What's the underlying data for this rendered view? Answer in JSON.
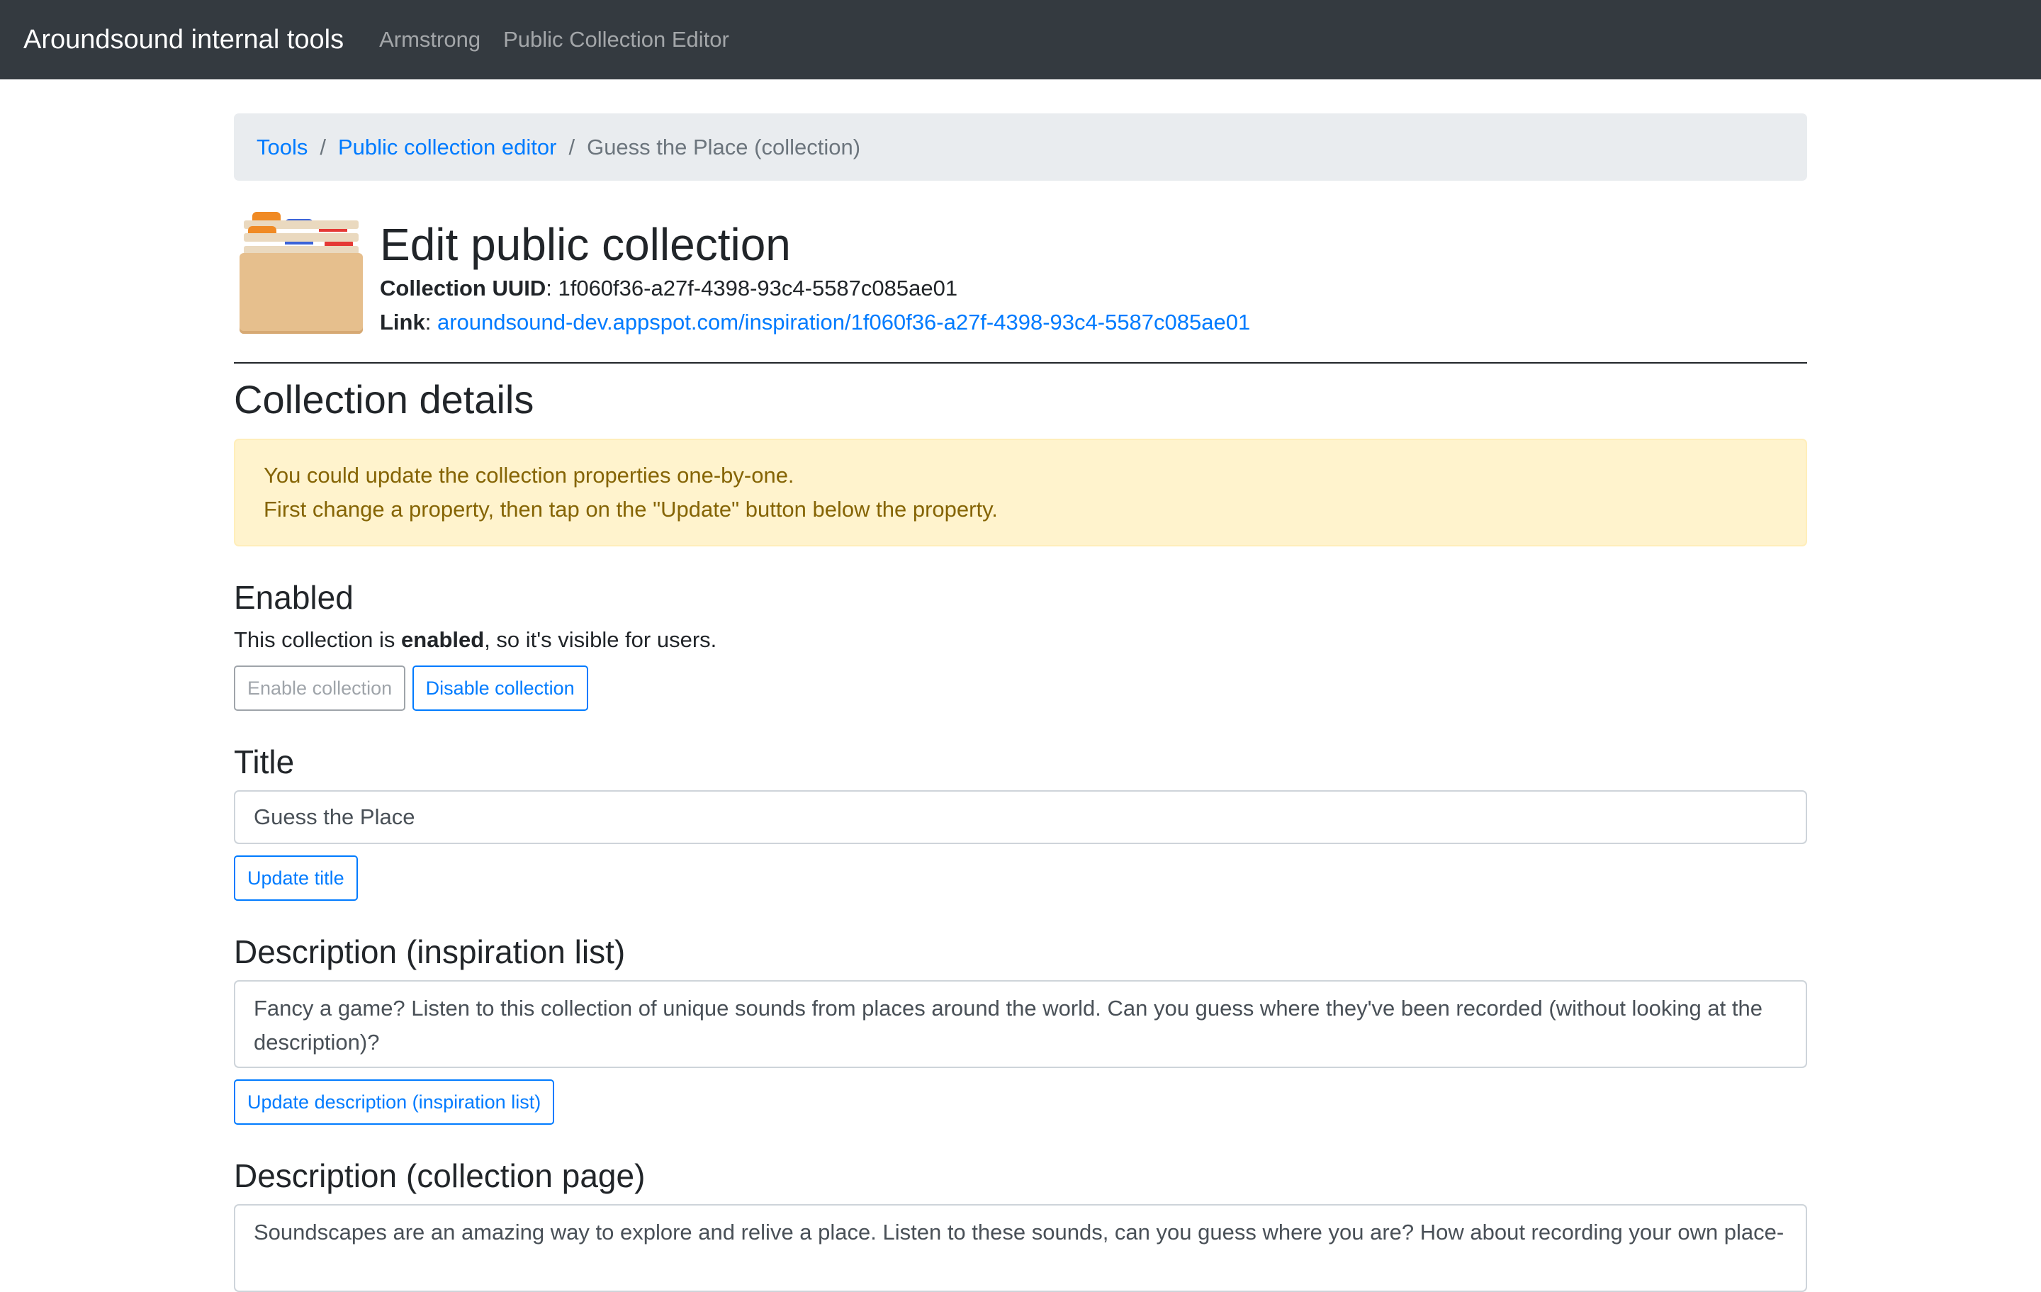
{
  "navbar": {
    "brand": "Aroundsound internal tools",
    "links": [
      "Armstrong",
      "Public Collection Editor"
    ]
  },
  "breadcrumb": {
    "items": [
      "Tools",
      "Public collection editor"
    ],
    "active": "Guess the Place (collection)"
  },
  "header": {
    "icon": "card-file-box-icon",
    "title": "Edit public collection",
    "uuid_label": "Collection UUID",
    "uuid_value": "1f060f36-a27f-4398-93c4-5587c085ae01",
    "link_label": "Link",
    "link_value": "aroundsound-dev.appspot.com/inspiration/1f060f36-a27f-4398-93c4-5587c085ae01"
  },
  "details": {
    "heading": "Collection details",
    "alert_line1": "You could update the collection properties one-by-one.",
    "alert_line2": "First change a property, then tap on the \"Update\" button below the property."
  },
  "enabled": {
    "heading": "Enabled",
    "text_before": "This collection is ",
    "text_bold": "enabled",
    "text_after": ", so it's visible for users.",
    "enable_button": "Enable collection",
    "disable_button": "Disable collection"
  },
  "title_section": {
    "heading": "Title",
    "value": "Guess the Place",
    "button": "Update title"
  },
  "desc_inspiration": {
    "heading": "Description (inspiration list)",
    "value": "Fancy a game? Listen to this collection of unique sounds from places around the world. Can you guess where they've been recorded (without looking at the description)?",
    "button": "Update description (inspiration list)"
  },
  "desc_collection": {
    "heading": "Description (collection page)",
    "value": "Soundscapes are an amazing way to explore and relive a place. Listen to these sounds, can you guess where you are? How about recording your own place-"
  },
  "colors": {
    "navbar": "#343a40",
    "primary": "#007bff",
    "alert_bg": "#fff3cd",
    "alert_text": "#856404"
  }
}
